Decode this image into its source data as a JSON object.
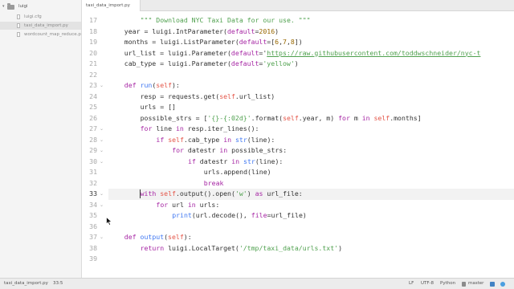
{
  "sidebar": {
    "folder": "luigi",
    "files": [
      "luigi.cfg",
      "taxi_data_import.py",
      "wordcount_map_reduce.py"
    ]
  },
  "tabs": [
    "taxi_data_import.py"
  ],
  "editor": {
    "current_line": 33,
    "lines": [
      {
        "n": 17,
        "fold": false,
        "indent": 8,
        "tokens": [
          [
            "\"\"\" Download NYC Taxi Data for our use. \"\"\"",
            "str"
          ]
        ]
      },
      {
        "n": 18,
        "fold": false,
        "indent": 4,
        "tokens": [
          [
            "year = luigi.IntParameter(",
            ""
          ],
          [
            "default",
            "kw"
          ],
          [
            "=",
            ""
          ],
          [
            "2016",
            "num"
          ],
          [
            ")",
            ""
          ]
        ]
      },
      {
        "n": 19,
        "fold": false,
        "indent": 4,
        "tokens": [
          [
            "months = luigi.ListParameter(",
            ""
          ],
          [
            "default",
            "kw"
          ],
          [
            "=[",
            ""
          ],
          [
            "6",
            "num"
          ],
          [
            ",",
            ""
          ],
          [
            "7",
            "num"
          ],
          [
            ",",
            ""
          ],
          [
            "8",
            "num"
          ],
          [
            "])",
            ""
          ]
        ]
      },
      {
        "n": 20,
        "fold": false,
        "indent": 4,
        "tokens": [
          [
            "url_list = luigi.Parameter(",
            ""
          ],
          [
            "default",
            "kw"
          ],
          [
            "='",
            ""
          ],
          [
            "https://raw.githubusercontent.com/toddwschneider/nyc-t",
            "url"
          ]
        ]
      },
      {
        "n": 21,
        "fold": false,
        "indent": 4,
        "tokens": [
          [
            "cab_type = luigi.Parameter(",
            ""
          ],
          [
            "default",
            "kw"
          ],
          [
            "=",
            ""
          ],
          [
            "'yellow'",
            "str"
          ],
          [
            ")",
            ""
          ]
        ]
      },
      {
        "n": 22,
        "fold": false,
        "indent": 0,
        "tokens": []
      },
      {
        "n": 23,
        "fold": true,
        "indent": 4,
        "tokens": [
          [
            "def",
            "kw"
          ],
          [
            " ",
            ""
          ],
          [
            "run",
            "fn"
          ],
          [
            "(",
            ""
          ],
          [
            "self",
            "self"
          ],
          [
            "):",
            ""
          ]
        ]
      },
      {
        "n": 24,
        "fold": false,
        "indent": 8,
        "tokens": [
          [
            "resp = requests.get(",
            ""
          ],
          [
            "self",
            "self"
          ],
          [
            ".url_list)",
            ""
          ]
        ]
      },
      {
        "n": 25,
        "fold": false,
        "indent": 8,
        "tokens": [
          [
            "urls = []",
            ""
          ]
        ]
      },
      {
        "n": 26,
        "fold": false,
        "indent": 8,
        "tokens": [
          [
            "possible_strs = [",
            ""
          ],
          [
            "'{}-{:02d}'",
            "str"
          ],
          [
            ".format(",
            ""
          ],
          [
            "self",
            "self"
          ],
          [
            ".year, m) ",
            ""
          ],
          [
            "for",
            "kw"
          ],
          [
            " m ",
            ""
          ],
          [
            "in",
            "kw"
          ],
          [
            " ",
            ""
          ],
          [
            "self",
            "self"
          ],
          [
            ".months]",
            ""
          ]
        ]
      },
      {
        "n": 27,
        "fold": true,
        "indent": 8,
        "tokens": [
          [
            "for",
            "kw"
          ],
          [
            " line ",
            ""
          ],
          [
            "in",
            "kw"
          ],
          [
            " resp.iter_lines():",
            ""
          ]
        ]
      },
      {
        "n": 28,
        "fold": true,
        "indent": 12,
        "tokens": [
          [
            "if",
            "kw"
          ],
          [
            " ",
            ""
          ],
          [
            "self",
            "self"
          ],
          [
            ".cab_type ",
            ""
          ],
          [
            "in",
            "kw"
          ],
          [
            " ",
            ""
          ],
          [
            "str",
            "fn"
          ],
          [
            "(line):",
            ""
          ]
        ]
      },
      {
        "n": 29,
        "fold": true,
        "indent": 16,
        "tokens": [
          [
            "for",
            "kw"
          ],
          [
            " datestr ",
            ""
          ],
          [
            "in",
            "kw"
          ],
          [
            " possible_strs:",
            ""
          ]
        ]
      },
      {
        "n": 30,
        "fold": true,
        "indent": 20,
        "tokens": [
          [
            "if",
            "kw"
          ],
          [
            " datestr ",
            ""
          ],
          [
            "in",
            "kw"
          ],
          [
            " ",
            ""
          ],
          [
            "str",
            "fn"
          ],
          [
            "(line):",
            ""
          ]
        ]
      },
      {
        "n": 31,
        "fold": false,
        "indent": 24,
        "tokens": [
          [
            "urls.append(line)",
            ""
          ]
        ]
      },
      {
        "n": 32,
        "fold": false,
        "indent": 24,
        "tokens": [
          [
            "break",
            "kw"
          ]
        ]
      },
      {
        "n": 33,
        "fold": true,
        "indent": 8,
        "tokens": [
          [
            "with",
            "kw"
          ],
          [
            " ",
            ""
          ],
          [
            "self",
            "self"
          ],
          [
            ".output().open(",
            ""
          ],
          [
            "'w'",
            "str"
          ],
          [
            ") ",
            ""
          ],
          [
            "as",
            "kw"
          ],
          [
            " url_file:",
            ""
          ]
        ]
      },
      {
        "n": 34,
        "fold": true,
        "indent": 12,
        "tokens": [
          [
            "for",
            "kw"
          ],
          [
            " url ",
            ""
          ],
          [
            "in",
            "kw"
          ],
          [
            " urls:",
            ""
          ]
        ]
      },
      {
        "n": 35,
        "fold": false,
        "indent": 16,
        "tokens": [
          [
            "print",
            "fn"
          ],
          [
            "(url.decode(), ",
            ""
          ],
          [
            "file",
            "kw"
          ],
          [
            "=url_file)",
            ""
          ]
        ]
      },
      {
        "n": 36,
        "fold": false,
        "indent": 0,
        "tokens": []
      },
      {
        "n": 37,
        "fold": true,
        "indent": 4,
        "tokens": [
          [
            "def",
            "kw"
          ],
          [
            " ",
            ""
          ],
          [
            "output",
            "fn"
          ],
          [
            "(",
            ""
          ],
          [
            "self",
            "self"
          ],
          [
            "):",
            ""
          ]
        ]
      },
      {
        "n": 38,
        "fold": false,
        "indent": 8,
        "tokens": [
          [
            "return",
            "kw"
          ],
          [
            " luigi.LocalTarget(",
            ""
          ],
          [
            "'/tmp/taxi_data/urls.txt'",
            "str"
          ],
          [
            ")",
            ""
          ]
        ]
      },
      {
        "n": 39,
        "fold": false,
        "indent": 0,
        "tokens": []
      }
    ]
  },
  "statusbar": {
    "file": "taxi_data_import.py",
    "position": "33:5",
    "line_ending": "LF",
    "encoding": "UTF-8",
    "language": "Python",
    "branch": "master"
  },
  "colors": {
    "keyword": "#a626a4",
    "string": "#50a14f",
    "number": "#986801",
    "self": "#e45649",
    "function": "#4078f2"
  }
}
